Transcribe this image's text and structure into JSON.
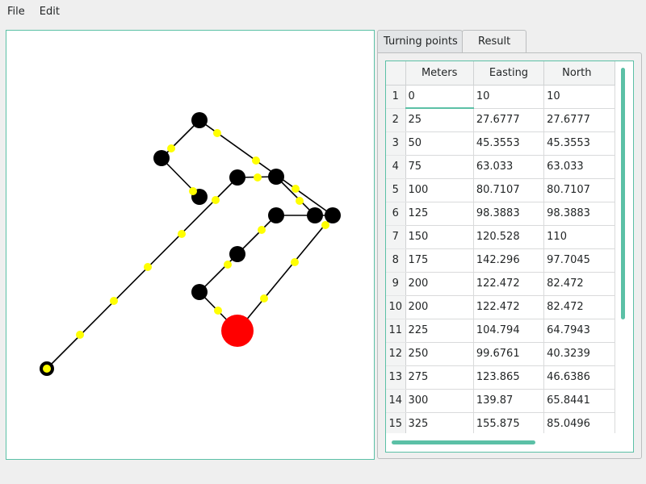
{
  "menu": {
    "file": "File",
    "edit": "Edit"
  },
  "tabs": {
    "turning_points": "Turning points",
    "result": "Result"
  },
  "table": {
    "headers": [
      "Meters",
      "Easting",
      "North"
    ],
    "rows": [
      [
        "1",
        "0",
        "10",
        "10"
      ],
      [
        "2",
        "25",
        "27.6777",
        "27.6777"
      ],
      [
        "3",
        "50",
        "45.3553",
        "45.3553"
      ],
      [
        "4",
        "75",
        "63.033",
        "63.033"
      ],
      [
        "5",
        "100",
        "80.7107",
        "80.7107"
      ],
      [
        "6",
        "125",
        "98.3883",
        "98.3883"
      ],
      [
        "7",
        "150",
        "120.528",
        "110"
      ],
      [
        "8",
        "175",
        "142.296",
        "97.7045"
      ],
      [
        "9",
        "200",
        "122.472",
        "82.472"
      ],
      [
        "10",
        "200",
        "122.472",
        "82.472"
      ],
      [
        "11",
        "225",
        "104.794",
        "64.7943"
      ],
      [
        "12",
        "250",
        "99.6761",
        "40.3239"
      ],
      [
        "13",
        "275",
        "123.865",
        "46.6386"
      ],
      [
        "14",
        "300",
        "139.87",
        "65.8441"
      ],
      [
        "15",
        "325",
        "155.875",
        "85.0496"
      ]
    ]
  },
  "colors": {
    "accent": "#5bc0a6",
    "turning_point": "#000000",
    "interval_marker": "#ffff00",
    "end_point": "#ff0000",
    "path_line": "#000000"
  }
}
